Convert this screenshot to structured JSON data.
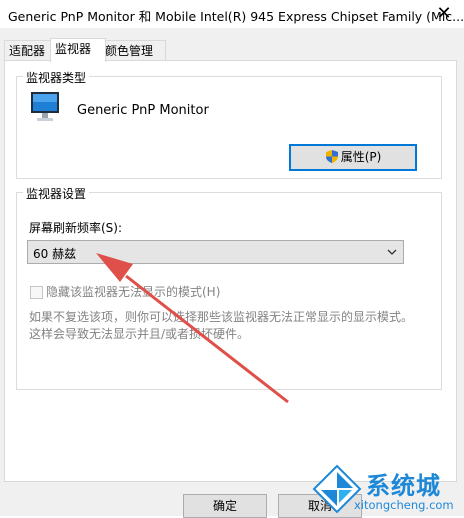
{
  "window": {
    "title": "Generic PnP Monitor 和 Mobile Intel(R) 945 Express Chipset Family (Mic...",
    "close_glyph": "✕"
  },
  "tabs": [
    {
      "label": "适配器"
    },
    {
      "label": "监视器"
    },
    {
      "label": "颜色管理"
    }
  ],
  "monitor_type": {
    "group_label": "监视器类型",
    "monitor_name": "Generic PnP Monitor",
    "properties_button": "属性(P)"
  },
  "monitor_settings": {
    "group_label": "监视器设置",
    "refresh_label": "屏幕刷新频率(S):",
    "refresh_value": "60 赫兹",
    "hide_modes_label": "隐藏该监视器无法显示的模式(H)",
    "hide_modes_checked": false,
    "description": [
      "如果不复选该项，则你可以选择那些该监视器无法正常显示的显示模式。",
      "这样会导致无法显示并且/或者损坏硬件。"
    ]
  },
  "buttons": {
    "ok": "确定",
    "cancel": "取消"
  },
  "watermark": {
    "brand": "系统城",
    "url": "xitongcheng.com"
  },
  "colors": {
    "accent": "#0078d7",
    "arrow": "#e0504a",
    "brand_blue": "#1e88d8"
  }
}
